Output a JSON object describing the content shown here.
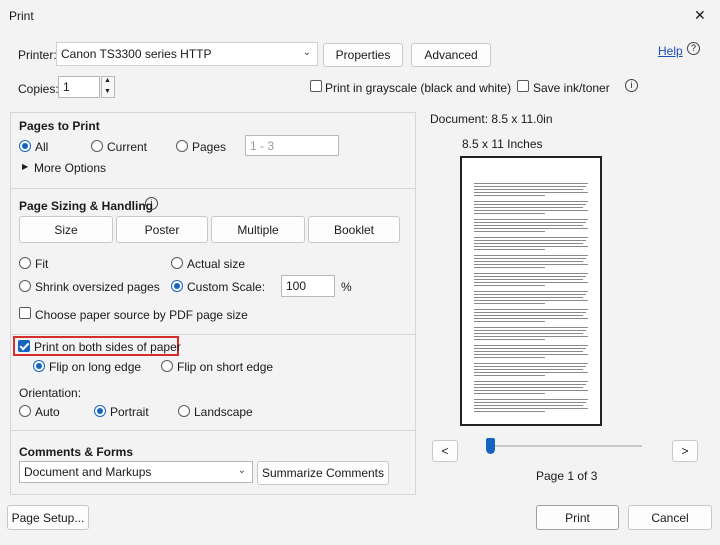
{
  "window": {
    "title": "Print",
    "close_glyph": "✕"
  },
  "header": {
    "printer_label": "Printer:",
    "printer_value": "Canon TS3300 series HTTP",
    "properties_label": "Properties",
    "advanced_label": "Advanced",
    "help_label": "Help",
    "copies_label": "Copies:",
    "copies_value": "1",
    "grayscale_label": "Print in grayscale (black and white)",
    "save_ink_label": "Save ink/toner"
  },
  "pages_to_print": {
    "title": "Pages to Print",
    "all_label": "All",
    "current_label": "Current",
    "pages_label": "Pages",
    "pages_value": "1 - 3",
    "more_options_label": "More Options"
  },
  "sizing": {
    "title": "Page Sizing & Handling",
    "tabs": [
      "Size",
      "Poster",
      "Multiple",
      "Booklet"
    ],
    "fit_label": "Fit",
    "actual_size_label": "Actual size",
    "shrink_label": "Shrink oversized pages",
    "custom_scale_label": "Custom Scale:",
    "custom_scale_value": "100",
    "percent_label": "%",
    "paper_source_label": "Choose paper source by PDF page size",
    "both_sides_label": "Print on both sides of paper",
    "long_edge_label": "Flip on long edge",
    "short_edge_label": "Flip on short edge",
    "orientation_label": "Orientation:",
    "auto_label": "Auto",
    "portrait_label": "Portrait",
    "landscape_label": "Landscape"
  },
  "comments": {
    "title": "Comments & Forms",
    "select_value": "Document and Markups",
    "summarize_label": "Summarize Comments"
  },
  "preview": {
    "document_label": "Document: 8.5 x 11.0in",
    "size_label": "8.5 x 11 Inches",
    "prev_glyph": "<",
    "next_glyph": ">",
    "page_status": "Page 1 of 3",
    "slider_fraction": 0.0
  },
  "footer": {
    "page_setup_label": "Page Setup...",
    "print_label": "Print",
    "cancel_label": "Cancel"
  },
  "colors": {
    "accent": "#1565c0",
    "highlight": "#d32f2f"
  }
}
